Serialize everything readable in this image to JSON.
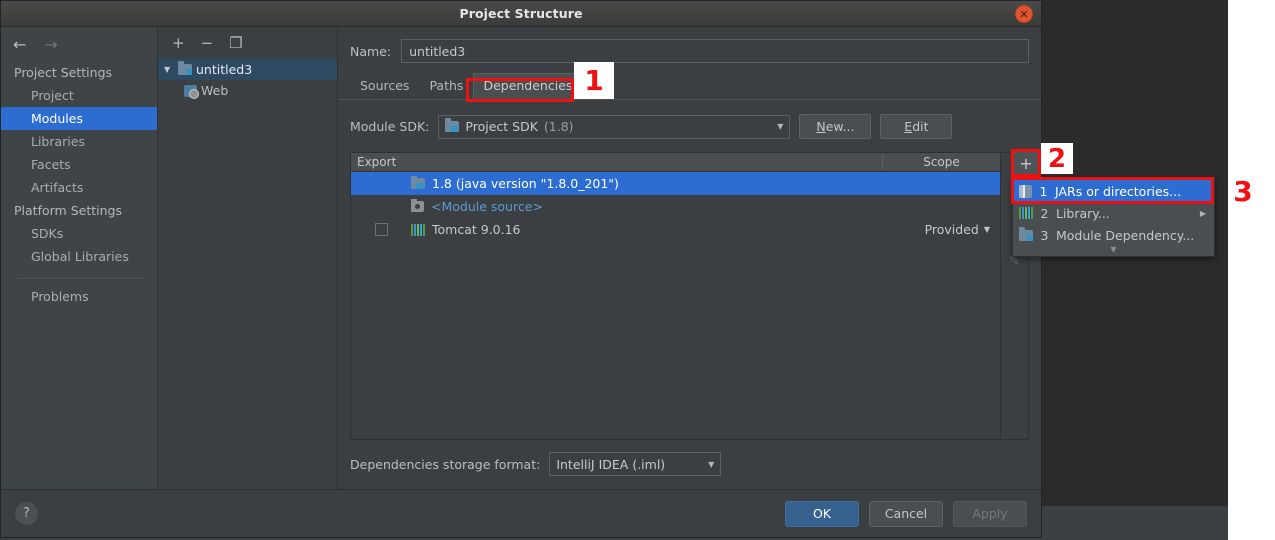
{
  "window": {
    "title": "Project Structure",
    "close_icon": "close-icon"
  },
  "sidebar": {
    "back_icon": "←",
    "forward_icon": "→",
    "groups": [
      {
        "label": "Project Settings",
        "items": [
          {
            "label": "Project",
            "selected": false
          },
          {
            "label": "Modules",
            "selected": true
          },
          {
            "label": "Libraries",
            "selected": false
          },
          {
            "label": "Facets",
            "selected": false
          },
          {
            "label": "Artifacts",
            "selected": false
          }
        ]
      },
      {
        "label": "Platform Settings",
        "items": [
          {
            "label": "SDKs",
            "selected": false
          },
          {
            "label": "Global Libraries",
            "selected": false
          }
        ]
      }
    ],
    "problems_label": "Problems"
  },
  "tree": {
    "toolbar": {
      "add": "+",
      "remove": "−",
      "copy": "❐"
    },
    "nodes": [
      {
        "label": "untitled3",
        "icon": "module-icon",
        "caret": "▼",
        "selected": true,
        "child": false
      },
      {
        "label": "Web",
        "icon": "web-facet-icon",
        "caret": "",
        "selected": false,
        "child": true
      }
    ]
  },
  "main": {
    "name_label": "Name:",
    "name_value": "untitled3",
    "tabs": [
      {
        "label": "Sources",
        "active": false
      },
      {
        "label": "Paths",
        "active": false
      },
      {
        "label": "Dependencies",
        "active": true
      }
    ],
    "sdk_label": "Module SDK:",
    "sdk_value": "Project SDK",
    "sdk_value_suffix": "(1.8)",
    "new_button": "New...",
    "new_button_mnemonic": "N",
    "edit_button": "Edit",
    "edit_button_mnemonic": "E",
    "table": {
      "headers": {
        "export": "Export",
        "scope": "Scope"
      },
      "rows": [
        {
          "export_checkbox": false,
          "has_checkbox": false,
          "icon": "jdk-icon",
          "label": "1.8 (java version \"1.8.0_201\")",
          "scope": "",
          "scope_dropdown": false,
          "selected": true,
          "link": false
        },
        {
          "export_checkbox": false,
          "has_checkbox": false,
          "icon": "module-source-icon",
          "label": "<Module source>",
          "scope": "",
          "scope_dropdown": false,
          "selected": false,
          "link": true
        },
        {
          "export_checkbox": false,
          "has_checkbox": true,
          "icon": "library-icon",
          "label": "Tomcat 9.0.16",
          "scope": "Provided",
          "scope_dropdown": true,
          "selected": false,
          "link": false
        }
      ],
      "side_buttons": [
        {
          "name": "add-dependency-button",
          "glyph": "+",
          "active": true
        },
        {
          "name": "remove-dependency-button",
          "glyph": "−",
          "active": false
        },
        {
          "name": "move-up-button",
          "glyph": "▲",
          "active": false
        },
        {
          "name": "move-down-button",
          "glyph": "▼",
          "active": false
        },
        {
          "name": "edit-dependency-button",
          "glyph": "✎",
          "active": false
        }
      ]
    },
    "storage_label": "Dependencies storage format:",
    "storage_value": "IntelliJ IDEA (.iml)"
  },
  "popup_menu": {
    "items": [
      {
        "num": "1",
        "label": "JARs or directories...",
        "icon": "jar-icon",
        "selected": true,
        "submenu": false
      },
      {
        "num": "2",
        "label": "Library...",
        "icon": "library-icon",
        "selected": false,
        "submenu": true
      },
      {
        "num": "3",
        "label": "Module Dependency...",
        "icon": "module-icon",
        "selected": false,
        "submenu": false
      }
    ]
  },
  "footer": {
    "help_label": "?",
    "ok": "OK",
    "cancel": "Cancel",
    "apply": "Apply"
  },
  "annotations": [
    {
      "num": "1"
    },
    {
      "num": "2"
    },
    {
      "num": "3"
    }
  ],
  "colors": {
    "accent_selection": "#2d6cd0",
    "annotation_red": "#ee1111",
    "dialog_bg": "#3c3f41",
    "sidebar_bg": "#3f4447",
    "primary_button": "#36618f"
  }
}
